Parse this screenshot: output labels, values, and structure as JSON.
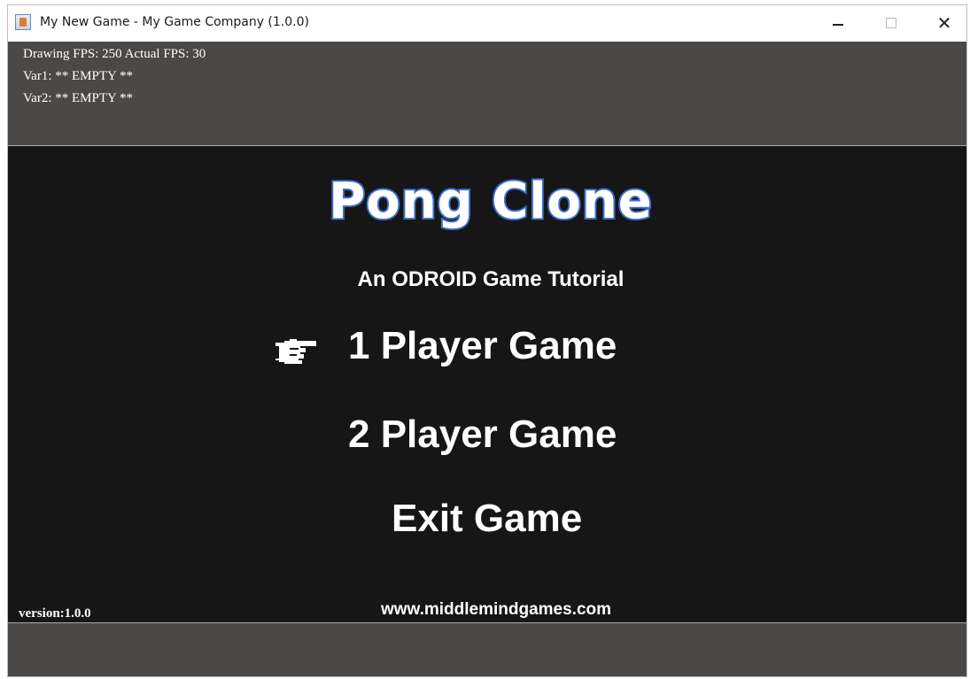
{
  "window": {
    "title": "My New Game - My Game Company (1.0.0)",
    "controls": {
      "minimize_icon": "minimize-icon",
      "maximize_icon": "maximize-icon",
      "close_icon": "close-icon",
      "close_glyph": "✕"
    }
  },
  "debug": {
    "fps_line": "Drawing FPS: 250 Actual FPS: 30",
    "var1_line": "Var1: ** EMPTY **",
    "var2_line": "Var2: ** EMPTY **"
  },
  "game": {
    "logo_text": "Pong Clone",
    "subtitle": "An ODROID Game Tutorial",
    "menu": [
      {
        "label": "1 Player Game",
        "selected": true
      },
      {
        "label": "2 Player Game",
        "selected": false
      },
      {
        "label": "Exit Game",
        "selected": false
      }
    ],
    "cursor_icon": "pointing-hand-icon",
    "version": "version:1.0.0",
    "website": "www.middlemindgames.com"
  },
  "colors": {
    "debug_bg": "#4b4948",
    "game_bg": "#161616",
    "logo_outline": "#3f6fd0",
    "text": "#ffffff"
  }
}
